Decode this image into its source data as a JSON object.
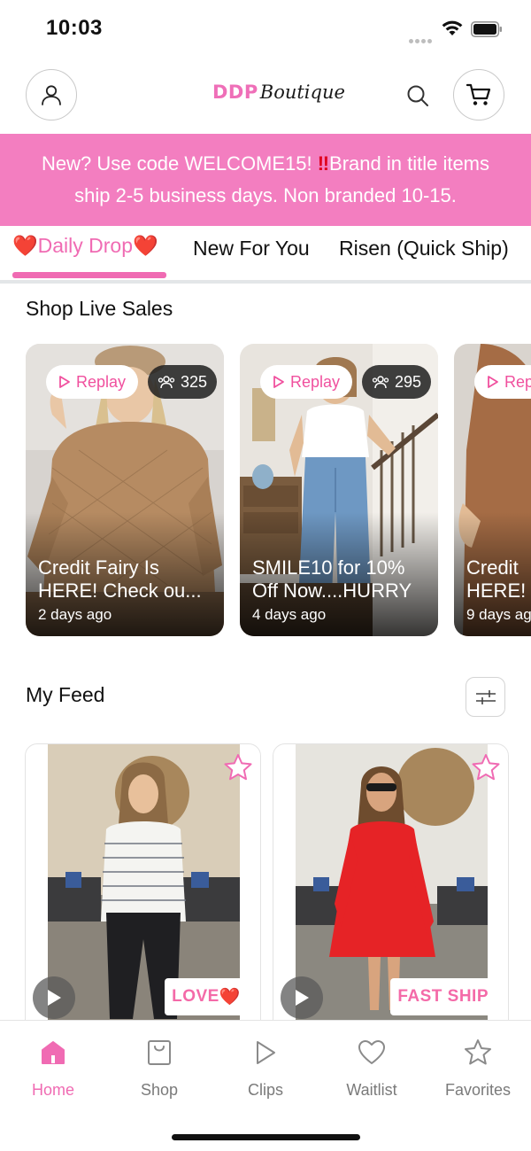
{
  "status_bar": {
    "time": "10:03"
  },
  "header": {
    "logo_brand": "DDP",
    "logo_script": "Boutique"
  },
  "promo": {
    "line1_before": "New? Use code WELCOME15! ",
    "line1_mark": "‼",
    "line1_after": "Brand in title items",
    "line2": "ship 2-5 business days. Non branded 10-15."
  },
  "tabs": [
    {
      "label": "Daily Drop",
      "active": true,
      "heart": "❤️"
    },
    {
      "label": "New For You",
      "active": false
    },
    {
      "label": "Risen (Quick Ship)",
      "active": false
    }
  ],
  "live_sales": {
    "title": "Shop Live Sales",
    "cards": [
      {
        "replay_label": "Replay",
        "viewers": "325",
        "caption_line1": "Credit Fairy Is",
        "caption_line2": "HERE! Check ou...",
        "age": "2 days ago"
      },
      {
        "replay_label": "Replay",
        "viewers": "295",
        "caption_line1": "SMILE10 for 10%",
        "caption_line2": "Off Now....HURRY",
        "age": "4 days ago"
      },
      {
        "replay_label": "Rep",
        "caption_line1": "Credit",
        "caption_line2": "HERE!",
        "age": "9 days ag"
      }
    ]
  },
  "feed": {
    "title": "My Feed",
    "cards": [
      {
        "badge_text": "LOVE",
        "badge_heart": "❤️"
      },
      {
        "badge_text": "FAST SHIP"
      }
    ]
  },
  "bottom_nav": [
    {
      "label": "Home",
      "active": true
    },
    {
      "label": "Shop",
      "active": false
    },
    {
      "label": "Clips",
      "active": false
    },
    {
      "label": "Waitlist",
      "active": false
    },
    {
      "label": "Favorites",
      "active": false
    }
  ],
  "colors": {
    "brand_pink": "#f37ec0",
    "accent_pink": "#f06bb3",
    "heart_red": "#e2222f"
  }
}
